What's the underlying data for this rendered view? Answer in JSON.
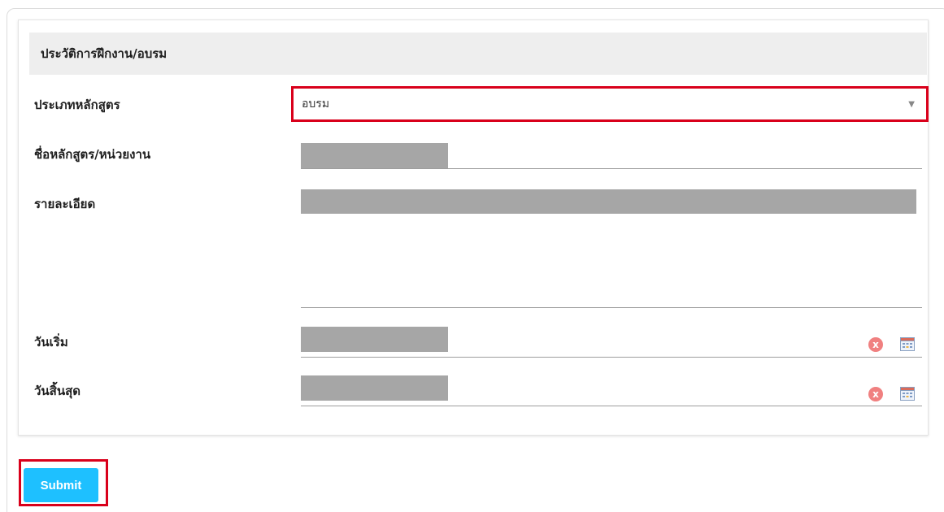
{
  "section": {
    "title": "ประวัติการฝึกงาน/อบรม"
  },
  "fields": {
    "course_type": {
      "label": "ประเภทหลักสูตร",
      "value": "อบรม"
    },
    "course_name": {
      "label": "ชื่อหลักสูตร/หน่วยงาน"
    },
    "details": {
      "label": "รายละเอียด"
    },
    "start_date": {
      "label": "วันเริ่ม"
    },
    "end_date": {
      "label": "วันสิ้นสุด"
    }
  },
  "icons": {
    "clear": "x-circle-icon",
    "calendar": "calendar-icon",
    "dropdown": "chevron-down-icon"
  },
  "actions": {
    "submit_label": "Submit"
  },
  "colors": {
    "highlight": "#d9001b",
    "submit_bg": "#1ec0ff",
    "header_bg": "#eeeeee",
    "redacted": "#a6a6a6",
    "clear_icon": "#f08080"
  }
}
